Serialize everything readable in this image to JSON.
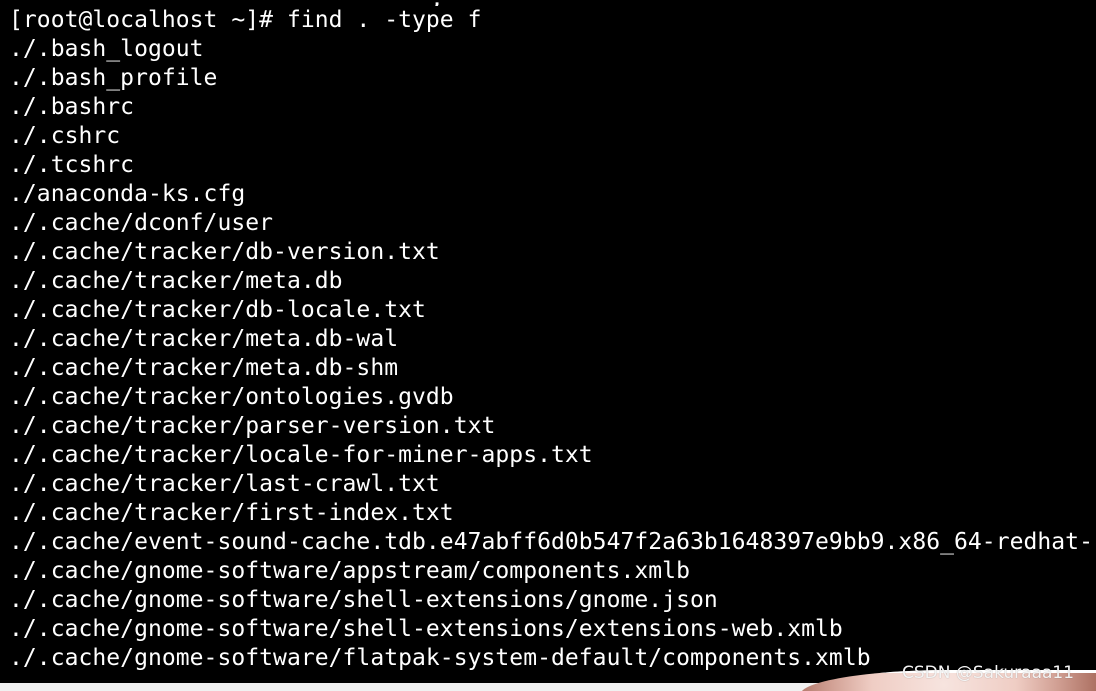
{
  "terminal": {
    "prompt_line": "[root@localhost ~]# find . -type f",
    "output_lines": [
      "./.bash_logout",
      "./.bash_profile",
      "./.bashrc",
      "./.cshrc",
      "./.tcshrc",
      "./anaconda-ks.cfg",
      "./.cache/dconf/user",
      "./.cache/tracker/db-version.txt",
      "./.cache/tracker/meta.db",
      "./.cache/tracker/db-locale.txt",
      "./.cache/tracker/meta.db-wal",
      "./.cache/tracker/meta.db-shm",
      "./.cache/tracker/ontologies.gvdb",
      "./.cache/tracker/parser-version.txt",
      "./.cache/tracker/locale-for-miner-apps.txt",
      "./.cache/tracker/last-crawl.txt",
      "./.cache/tracker/first-index.txt",
      "./.cache/event-sound-cache.tdb.e47abff6d0b547f2a63b1648397e9bb9.x86_64-redhat-",
      "./.cache/gnome-software/appstream/components.xmlb",
      "./.cache/gnome-software/shell-extensions/gnome.json",
      "./.cache/gnome-software/shell-extensions/extensions-web.xmlb",
      "./.cache/gnome-software/flatpak-system-default/components.xmlb"
    ]
  },
  "watermark": "CSDN @Sakuraaa11",
  "colors": {
    "background": "#000000",
    "text": "#ffffff",
    "bottom_strip": "#f1f1f1"
  }
}
